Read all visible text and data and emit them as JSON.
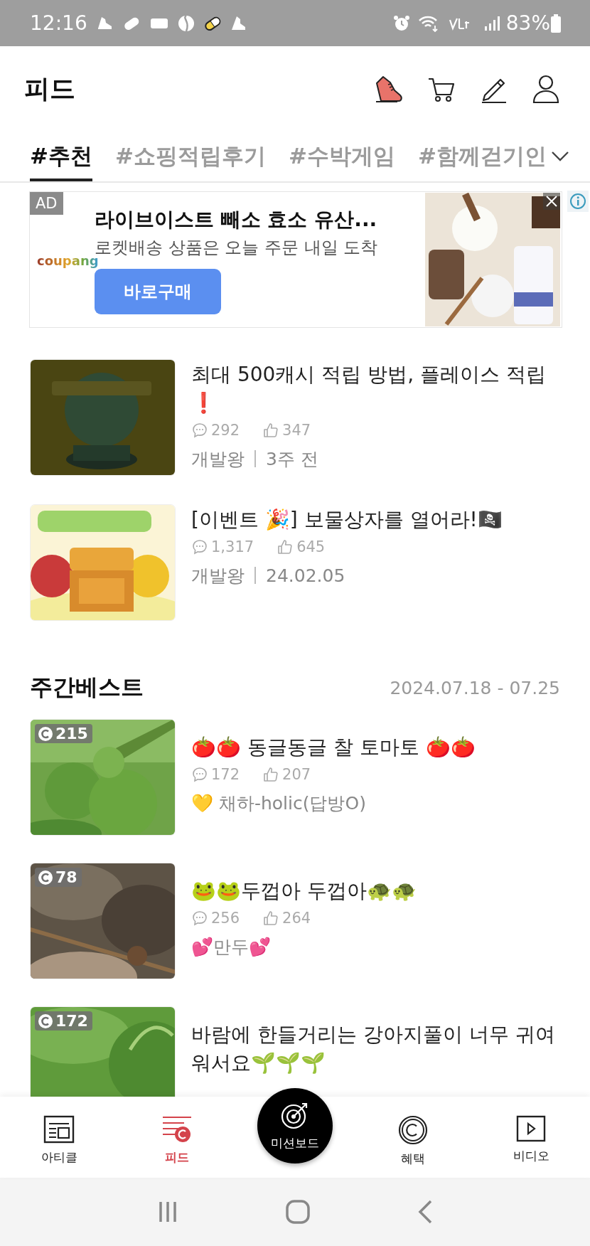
{
  "status_bar": {
    "time": "12:16",
    "battery": "83%"
  },
  "header": {
    "title": "피드"
  },
  "tabs": [
    {
      "label": "#추천",
      "selected": true
    },
    {
      "label": "#쇼핑적립후기",
      "selected": false
    },
    {
      "label": "#수박게임",
      "selected": false
    },
    {
      "label": "#함께걷기인",
      "selected": false
    }
  ],
  "ad": {
    "badge": "AD",
    "brand": "coupang",
    "title": "라이브이스트 빼소 효소 유산...",
    "subtitle": "로켓배송 상품은 오늘 주문 내일 도착",
    "button": "바로구매"
  },
  "articles": [
    {
      "title": "최대 500캐시 적립 방법, 플레이스 적립 ❗",
      "comments": "292",
      "likes": "347",
      "author": "개발왕",
      "date": "3주 전"
    },
    {
      "title": "[이벤트 🎉] 보물상자를 열어라!🏴‍☠️",
      "comments": "1,317",
      "likes": "645",
      "author": "개발왕",
      "date": "24.02.05"
    }
  ],
  "weekly_best": {
    "title": "주간베스트",
    "period": "2024.07.18 - 07.25",
    "items": [
      {
        "cash": "215",
        "title": "🍅🍅 동글동글 찰 토마토 🍅🍅",
        "comments": "172",
        "likes": "207",
        "author": "💛 채하-holic(답방O)"
      },
      {
        "cash": "78",
        "title": "🐸🐸두껍아 두껍아🐢🐢",
        "comments": "256",
        "likes": "264",
        "author": "💕만두💕"
      },
      {
        "cash": "172",
        "title": "바람에 한들거리는 강아지풀이 너무 귀여워서요🌱🌱🌱"
      }
    ]
  },
  "nav": {
    "items": [
      {
        "label": "아티클",
        "kind": "tab",
        "selected": false
      },
      {
        "label": "피드",
        "kind": "tab",
        "selected": true
      },
      {
        "label": "미션보드",
        "kind": "center",
        "selected": false
      },
      {
        "label": "혜택",
        "kind": "tab",
        "selected": false
      },
      {
        "label": "비디오",
        "kind": "tab",
        "selected": false
      }
    ]
  }
}
